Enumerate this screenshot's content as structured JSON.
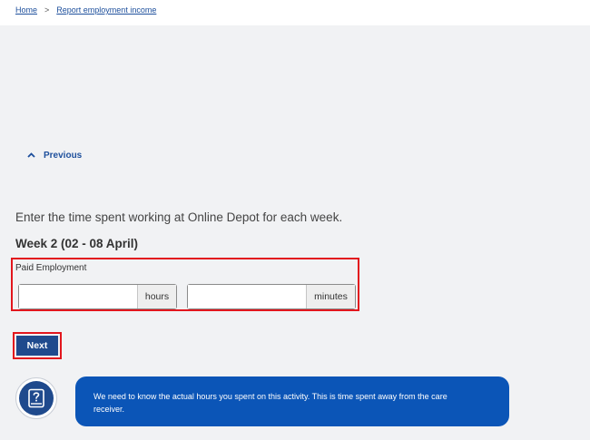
{
  "breadcrumb": {
    "home": "Home",
    "separator": ">",
    "current": "Report employment income"
  },
  "nav": {
    "previous_label": "Previous",
    "previous_icon": "chevron-up-icon"
  },
  "form": {
    "prompt": "Enter the time spent working at Online Depot for each week.",
    "week_heading": "Week 2 (02 - 08 April)",
    "field_label": "Paid Employment",
    "hours": {
      "value": "",
      "suffix": "hours"
    },
    "minutes": {
      "value": "",
      "suffix": "minutes"
    },
    "next_label": "Next"
  },
  "help": {
    "icon": "help-book-icon",
    "text": "We need to know the actual hours you spent on this activity. This is time spent away from the care receiver."
  },
  "colors": {
    "accent": "#1f4a8d",
    "link": "#1d4f9c",
    "highlight": "#e2161d",
    "help_bubble": "#0b55b7",
    "page_background": "#f1f2f4"
  }
}
